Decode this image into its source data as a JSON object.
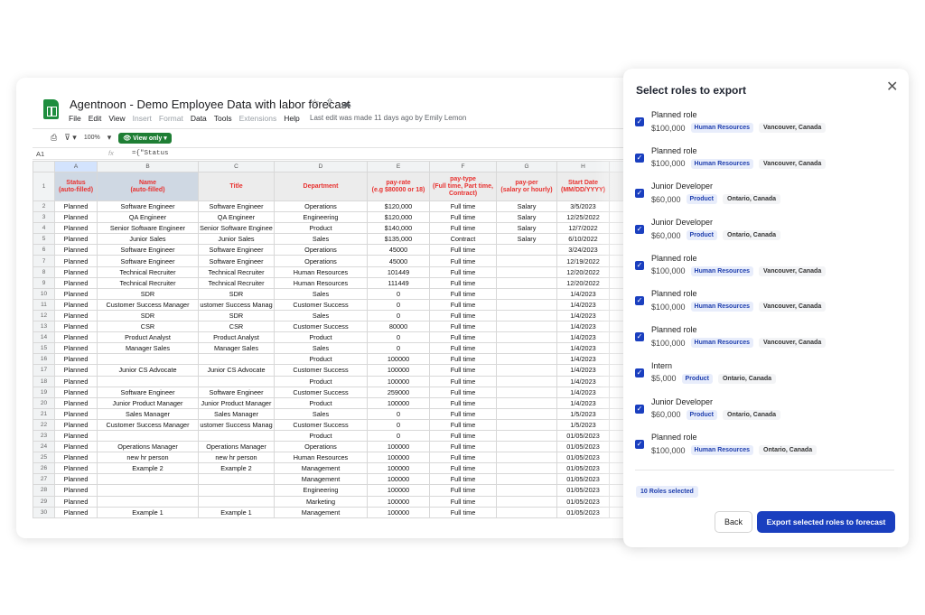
{
  "sheet": {
    "title": "Agentnoon - Demo Employee Data with labor forecast",
    "menu": [
      "File",
      "Edit",
      "View",
      "Insert",
      "Format",
      "Data",
      "Tools",
      "Extensions",
      "Help"
    ],
    "last_edit": "Last edit was made 11 days ago by Emily Lemon",
    "zoom": "100%",
    "view_mode": "View only",
    "cell_ref": "A1",
    "formula": "={\"Status",
    "col_letters": [
      "A",
      "B",
      "C",
      "D",
      "E",
      "F",
      "G",
      "H"
    ],
    "headers": [
      "Status\n(auto-filled)",
      "Name\n(auto-filled)",
      "Title",
      "Department",
      "pay-rate\n(e.g $80000 or 18)",
      "pay-type\n(Full time, Part time, Contract)",
      "pay-per\n(salary or hourly)",
      "Start Date\n(MM/DD/YYYY)"
    ],
    "rows": [
      [
        "2",
        "Planned",
        "Software Engineer",
        "Software Engineer",
        "Operations",
        "$120,000",
        "Full time",
        "Salary",
        "3/5/2023"
      ],
      [
        "3",
        "Planned",
        "QA Engineer",
        "QA Engineer",
        "Engineering",
        "$120,000",
        "Full time",
        "Salary",
        "12/25/2022"
      ],
      [
        "4",
        "Planned",
        "Senior Software Engineer",
        "Senior Software Enginee",
        "Product",
        "$140,000",
        "Full time",
        "Salary",
        "12/7/2022"
      ],
      [
        "5",
        "Planned",
        "Junior Sales",
        "Junior Sales",
        "Sales",
        "$135,000",
        "Contract",
        "Salary",
        "6/10/2022"
      ],
      [
        "6",
        "Planned",
        "Software Engineer",
        "Software Engineer",
        "Operations",
        "45000",
        "Full time",
        "",
        "3/24/2023"
      ],
      [
        "7",
        "Planned",
        "Software Engineer",
        "Software Engineer",
        "Operations",
        "45000",
        "Full time",
        "",
        "12/19/2022"
      ],
      [
        "8",
        "Planned",
        "Technical Recruiter",
        "Technical Recruiter",
        "Human Resources",
        "101449",
        "Full time",
        "",
        "12/20/2022"
      ],
      [
        "9",
        "Planned",
        "Technical Recruiter",
        "Technical Recruiter",
        "Human Resources",
        "111449",
        "Full time",
        "",
        "12/20/2022"
      ],
      [
        "10",
        "Planned",
        "SDR",
        "SDR",
        "Sales",
        "0",
        "Full time",
        "",
        "1/4/2023"
      ],
      [
        "11",
        "Planned",
        "Customer Success Manager",
        "ustomer Success Manag",
        "Customer Success",
        "0",
        "Full time",
        "",
        "1/4/2023"
      ],
      [
        "12",
        "Planned",
        "SDR",
        "SDR",
        "Sales",
        "0",
        "Full time",
        "",
        "1/4/2023"
      ],
      [
        "13",
        "Planned",
        "CSR",
        "CSR",
        "Customer Success",
        "80000",
        "Full time",
        "",
        "1/4/2023"
      ],
      [
        "14",
        "Planned",
        "Product Analyst",
        "Product Analyst",
        "Product",
        "0",
        "Full time",
        "",
        "1/4/2023"
      ],
      [
        "15",
        "Planned",
        "Manager Sales",
        "Manager Sales",
        "Sales",
        "0",
        "Full time",
        "",
        "1/4/2023"
      ],
      [
        "16",
        "Planned",
        "",
        "",
        "Product",
        "100000",
        "Full time",
        "",
        "1/4/2023"
      ],
      [
        "17",
        "Planned",
        "Junior CS Advocate",
        "Junior CS Advocate",
        "Customer Success",
        "100000",
        "Full time",
        "",
        "1/4/2023"
      ],
      [
        "18",
        "Planned",
        "",
        "",
        "Product",
        "100000",
        "Full time",
        "",
        "1/4/2023"
      ],
      [
        "19",
        "Planned",
        "Software Engineer",
        "Software Engineer",
        "Customer Success",
        "259000",
        "Full time",
        "",
        "1/4/2023"
      ],
      [
        "20",
        "Planned",
        "Junior Product Manager",
        "Junior Product Manager",
        "Product",
        "100000",
        "Full time",
        "",
        "1/4/2023"
      ],
      [
        "21",
        "Planned",
        "Sales Manager",
        "Sales Manager",
        "Sales",
        "0",
        "Full time",
        "",
        "1/5/2023"
      ],
      [
        "22",
        "Planned",
        "Customer Success Manager",
        "ustomer Success Manag",
        "Customer Success",
        "0",
        "Full time",
        "",
        "1/5/2023"
      ],
      [
        "23",
        "Planned",
        "",
        "",
        "Product",
        "0",
        "Full time",
        "",
        "01/05/2023"
      ],
      [
        "24",
        "Planned",
        "Operations Manager",
        "Operations Manager",
        "Operations",
        "100000",
        "Full time",
        "",
        "01/05/2023"
      ],
      [
        "25",
        "Planned",
        "new hr person",
        "new hr person",
        "Human Resources",
        "100000",
        "Full time",
        "",
        "01/05/2023"
      ],
      [
        "26",
        "Planned",
        "Example 2",
        "Example 2",
        "Management",
        "100000",
        "Full time",
        "",
        "01/05/2023"
      ],
      [
        "27",
        "Planned",
        "",
        "",
        "Management",
        "100000",
        "Full time",
        "",
        "01/05/2023"
      ],
      [
        "28",
        "Planned",
        "",
        "",
        "Engineering",
        "100000",
        "Full time",
        "",
        "01/05/2023"
      ],
      [
        "29",
        "Planned",
        "",
        "",
        "Marketing",
        "100000",
        "Full time",
        "",
        "01/05/2023"
      ],
      [
        "30",
        "Planned",
        "Example 1",
        "Example 1",
        "Management",
        "100000",
        "Full time",
        "",
        "01/05/2023"
      ]
    ]
  },
  "export_panel": {
    "title": "Select roles to export",
    "roles": [
      {
        "name": "Planned role",
        "salary": "$100,000",
        "department": "Human Resources",
        "location": "Vancouver, Canada"
      },
      {
        "name": "Planned role",
        "salary": "$100,000",
        "department": "Human Resources",
        "location": "Vancouver, Canada"
      },
      {
        "name": "Junior Developer",
        "salary": "$60,000",
        "department": "Product",
        "location": "Ontario, Canada"
      },
      {
        "name": "Junior Developer",
        "salary": "$60,000",
        "department": "Product",
        "location": "Ontario, Canada"
      },
      {
        "name": "Planned role",
        "salary": "$100,000",
        "department": "Human Resources",
        "location": "Vancouver, Canada"
      },
      {
        "name": "Planned role",
        "salary": "$100,000",
        "department": "Human Resources",
        "location": "Vancouver, Canada"
      },
      {
        "name": "Planned role",
        "salary": "$100,000",
        "department": "Human Resources",
        "location": "Vancouver, Canada"
      },
      {
        "name": "Intern",
        "salary": "$5,000",
        "department": "Product",
        "location": "Ontario, Canada"
      },
      {
        "name": "Junior Developer",
        "salary": "$60,000",
        "department": "Product",
        "location": "Ontario, Canada"
      },
      {
        "name": "Planned role",
        "salary": "$100,000",
        "department": "Human Resources",
        "location": "Ontario, Canada"
      }
    ],
    "selected_count": "10 Roles selected",
    "back_label": "Back",
    "export_label": "Export selected roles to forecast"
  }
}
